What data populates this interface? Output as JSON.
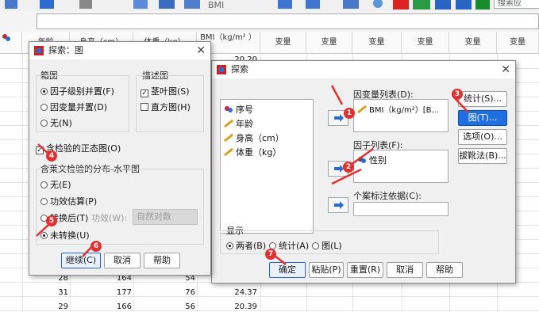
{
  "toolbar": {
    "search_placeholder": "搜索应"
  },
  "grid": {
    "headers": [
      "年龄",
      "身高（cm）",
      "体重（kg）",
      "BMI（kg/m² ）",
      "变量",
      "变量",
      "变量",
      "变量",
      "变量",
      "变量"
    ],
    "partial_value": "20.20",
    "rows": [
      [
        "28",
        "164",
        "54",
        ""
      ],
      [
        "31",
        "177",
        "76",
        "24.37"
      ],
      [
        "29",
        "166",
        "56",
        "20.39"
      ]
    ]
  },
  "plots_dialog": {
    "title": "探索：图",
    "boxplot_title": "箱图",
    "boxplot_options": [
      "因子级别并置(F)",
      "因变量并置(D)",
      "无(N)"
    ],
    "boxplot_selected": 0,
    "desc_title": "描述图",
    "desc_options": [
      {
        "label": "茎叶图(S)",
        "checked": true
      },
      {
        "label": "直方图(H)",
        "checked": false
      }
    ],
    "normality_label": "含检验的正态图(O)",
    "normality_checked": true,
    "levene_title": "含莱文检验的分布-水平图",
    "levene_options": [
      "无(E)",
      "功效估算(P)",
      "转换后(T)",
      "未转换(U)"
    ],
    "levene_selected": 3,
    "power_label": "功效(W):",
    "power_value": "自然对数",
    "buttons": {
      "continue": "继续(C)",
      "cancel": "取消",
      "help": "帮助"
    }
  },
  "explore_dialog": {
    "title": "探索",
    "variables": [
      "序号",
      "年龄",
      "身高（cm）",
      "体重（kg）"
    ],
    "dependent_label": "因变量列表(D):",
    "dependent_item": "BMI（kg/m²）[B...",
    "factor_label": "因子列表(F):",
    "factor_item": "性别",
    "case_label": "个案标注依据(C):",
    "side_buttons": [
      "统计(S)...",
      "图(T)...",
      "选项(O)...",
      "拔靴法(B)..."
    ],
    "display_title": "显示",
    "display_options": [
      "两者(B)",
      "统计(A)",
      "图(L)"
    ],
    "display_selected": 0,
    "buttons": {
      "ok": "确定",
      "paste": "粘贴(P)",
      "reset": "重置(R)",
      "cancel": "取消",
      "help": "帮助"
    }
  },
  "badges": [
    "1",
    "2",
    "3",
    "4",
    "5",
    "6",
    "7"
  ],
  "colors": {
    "accent": "#1f6fe0",
    "badge": "#e03030",
    "arrow": "#e03030"
  }
}
